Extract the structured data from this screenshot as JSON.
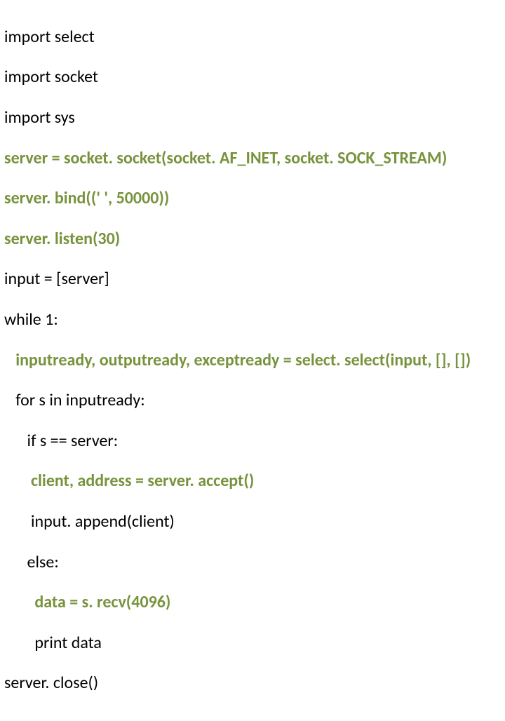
{
  "code": {
    "l01": "import select",
    "l02": "import socket",
    "l03": "import sys",
    "l04": "server = socket. socket(socket. AF_INET, socket. SOCK_STREAM)",
    "l05": "server. bind((' ', 50000))",
    "l06": "server. listen(30)",
    "l07": "input = [server]",
    "l08": "while 1:",
    "l09": "   inputready, outputready, exceptready = select. select(input, [], [])",
    "l10": "   for s in inputready:",
    "l11": "      if s == server:",
    "l12": "       client, address = server. accept()",
    "l13": "       input. append(client)",
    "l14": "      else:",
    "l15": "        data = s. recv(4096)",
    "l16": "        print data",
    "l17": "server. close()"
  }
}
